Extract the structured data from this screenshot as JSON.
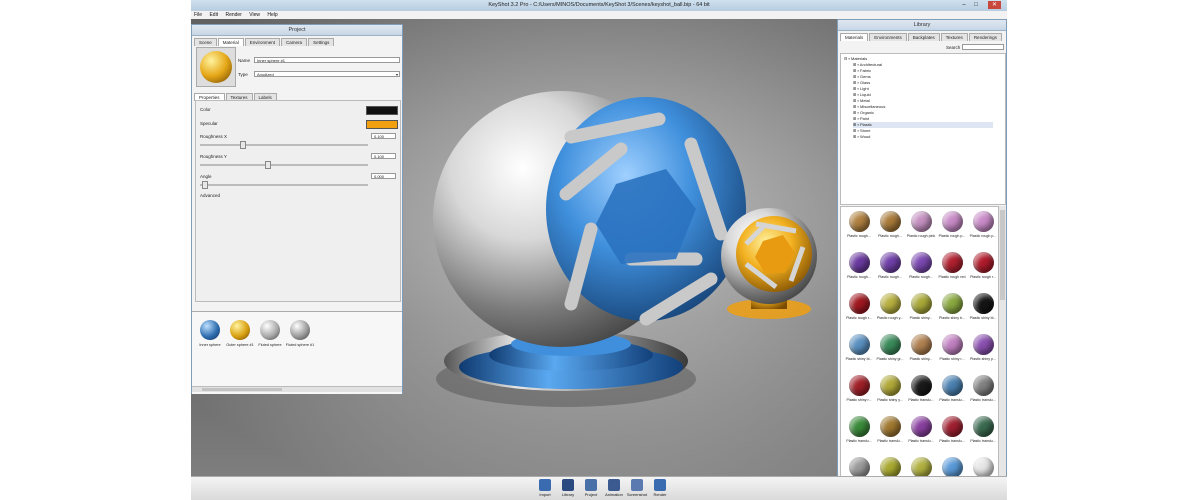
{
  "window": {
    "title": "KeyShot 3.2 Pro - C:/Users/MINOS/Documents/KeyShot 3/Scenes/keyshot_ball.bip - 64 bit",
    "controls": [
      "–",
      "□",
      "✕"
    ]
  },
  "menu": [
    "File",
    "Edit",
    "Render",
    "View",
    "Help"
  ],
  "project": {
    "title": "Project",
    "tabs": [
      "Scene",
      "Material",
      "Environment",
      "Camera",
      "Settings"
    ],
    "active_tab": "Material",
    "name_label": "Name",
    "name_value": "Inner sphere #1",
    "type_label": "Type",
    "type_value": "Anodized",
    "subtabs": [
      "Properties",
      "Textures",
      "Labels"
    ],
    "color_label": "Color",
    "color_value": "#111111",
    "specular_label": "Specular",
    "specular_value": "#f0a010",
    "rough_x_label": "Roughness X",
    "rough_x_value": "0.100",
    "rough_y_label": "Roughness Y",
    "rough_y_value": "0.100",
    "angle_label": "Angle",
    "angle_value": "0.000",
    "advanced_label": "Advanced",
    "thumbs": [
      {
        "label": "Inner sphere",
        "color": "#2f6fb0"
      },
      {
        "label": "Outer sphere #1",
        "color": "#d9a010"
      },
      {
        "label": "Fluted sphere",
        "color": "#a9a9a9"
      },
      {
        "label": "Fluted sphere #1",
        "color": "#9a9a9a"
      }
    ]
  },
  "library": {
    "title": "Library",
    "tabs": [
      "Materials",
      "Environments",
      "Backplates",
      "Textures",
      "Renderings"
    ],
    "search_label": "Search",
    "tree": [
      "Materials",
      "Architectural",
      "Fabric",
      "Gems",
      "Glass",
      "Light",
      "Liquid",
      "Metal",
      "Miscellaneous",
      "Organic",
      "Paint",
      "Plastic",
      "Stone",
      "Wood"
    ],
    "swatch_rows": [
      [
        {
          "label": "Plastic rough...",
          "color": "#b08040"
        },
        {
          "label": "Plastic rough...",
          "color": "#a87a3a"
        },
        {
          "label": "Plastic rough pink",
          "color": "#c490c0"
        },
        {
          "label": "Plastic rough p...",
          "color": "#c78ac6"
        },
        {
          "label": "Plastic rough p...",
          "color": "#c98ac8"
        }
      ],
      [
        {
          "label": "Plastic rough...",
          "color": "#6a3aa0"
        },
        {
          "label": "Plastic rough...",
          "color": "#7040a8"
        },
        {
          "label": "Plastic rough...",
          "color": "#7a48b0"
        },
        {
          "label": "Plastic rough red",
          "color": "#b02030"
        },
        {
          "label": "Plastic rough r...",
          "color": "#b01c2c"
        }
      ],
      [
        {
          "label": "Plastic rough r...",
          "color": "#a01820"
        },
        {
          "label": "Plastic rough y...",
          "color": "#b8b040"
        },
        {
          "label": "Plastic shiny...",
          "color": "#a8a838"
        },
        {
          "label": "Plastic shiny b...",
          "color": "#8aa840"
        },
        {
          "label": "Plastic shiny bl...",
          "color": "#151515"
        }
      ],
      [
        {
          "label": "Plastic shiny bl...",
          "color": "#5a90c0"
        },
        {
          "label": "Plastic shiny gr...",
          "color": "#3a8a5a"
        },
        {
          "label": "Plastic shiny...",
          "color": "#b08050"
        },
        {
          "label": "Plastic shiny r...",
          "color": "#c080c0"
        },
        {
          "label": "Plastic shiny p...",
          "color": "#8a50b0"
        }
      ],
      [
        {
          "label": "Plastic shiny r...",
          "color": "#a02028"
        },
        {
          "label": "Plastic shiny y...",
          "color": "#b0a838"
        },
        {
          "label": "Plastic translu...",
          "color": "#1a1a1a"
        },
        {
          "label": "Plastic translu...",
          "color": "#4a80b0"
        },
        {
          "label": "Plastic translu...",
          "color": "#808080"
        }
      ],
      [
        {
          "label": "Plastic translu...",
          "color": "#3a8a3a"
        },
        {
          "label": "Plastic translu...",
          "color": "#a07830"
        },
        {
          "label": "Plastic translu...",
          "color": "#8a40a0"
        },
        {
          "label": "Plastic translu...",
          "color": "#a02030"
        },
        {
          "label": "Plastic translu...",
          "color": "#3a6a50"
        }
      ],
      [
        {
          "label": "Plastic translu...",
          "color": "#9a9a9a"
        },
        {
          "label": "Plastic translu...",
          "color": "#a8a830"
        },
        {
          "label": "Plastic translu...",
          "color": "#b0b040"
        },
        {
          "label": "Polycarbon...",
          "color": "#5a9ad8"
        },
        {
          "label": "Polycarbon...",
          "color": "#e6e6e6"
        }
      ]
    ]
  },
  "toolbar": [
    {
      "label": "Import",
      "icon": "import-icon",
      "color": "#3a6ab0"
    },
    {
      "label": "Library",
      "icon": "library-icon",
      "color": "#2a4a80"
    },
    {
      "label": "Project",
      "icon": "project-icon",
      "color": "#4a70a8"
    },
    {
      "label": "Animation",
      "icon": "animation-icon",
      "color": "#3a5a90"
    },
    {
      "label": "Screenshot",
      "icon": "screenshot-icon",
      "color": "#5a7ab0"
    },
    {
      "label": "Render",
      "icon": "render-icon",
      "color": "#3a6ab0"
    }
  ],
  "colors": {
    "accent": "#2f6fb0",
    "gold": "#f0a010"
  }
}
